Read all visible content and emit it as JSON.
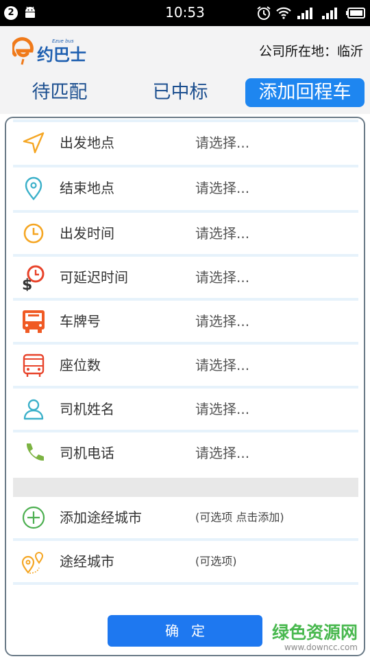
{
  "status_bar": {
    "notification_count": "2",
    "time": "10:53"
  },
  "header": {
    "logo_text": "e约巴士",
    "logo_subtext": "Ezue bus",
    "location_label": "公司所在地：临沂"
  },
  "tabs": [
    {
      "label": "待匹配",
      "active": false
    },
    {
      "label": "已中标",
      "active": false
    },
    {
      "label": "添加回程车",
      "active": true
    }
  ],
  "form": {
    "rows": [
      {
        "label": "出发地点",
        "value": "请选择...",
        "icon": "navigation-arrow-icon"
      },
      {
        "label": "结束地点",
        "value": "请选择...",
        "icon": "map-pin-icon"
      },
      {
        "label": "出发时间",
        "value": "请选择...",
        "icon": "clock-icon"
      },
      {
        "label": "可延迟时间",
        "value": "请选择...",
        "icon": "delay-time-dollar-icon"
      },
      {
        "label": "车牌号",
        "value": "请选择...",
        "icon": "bus-front-icon"
      },
      {
        "label": "座位数",
        "value": "请选择...",
        "icon": "bus-seat-icon"
      },
      {
        "label": "司机姓名",
        "value": "请选择...",
        "icon": "person-icon"
      },
      {
        "label": "司机电话",
        "value": "请选择...",
        "icon": "phone-icon"
      }
    ],
    "extra_rows": [
      {
        "label": "添加途经城市",
        "value": "(可选项 点击添加)",
        "icon": "add-circle-icon"
      },
      {
        "label": "途经城市",
        "value": "(可选项)",
        "icon": "route-pins-icon"
      }
    ],
    "confirm_label": "确定"
  },
  "watermark": {
    "name": "绿色资源网",
    "url": "www.downcc.com"
  },
  "colors": {
    "accent": "#1e86f0",
    "tab_text": "#1c4f8f",
    "orange": "#f5a623",
    "red": "#e8432a",
    "teal": "#3bb0c9",
    "green": "#7cb342"
  }
}
